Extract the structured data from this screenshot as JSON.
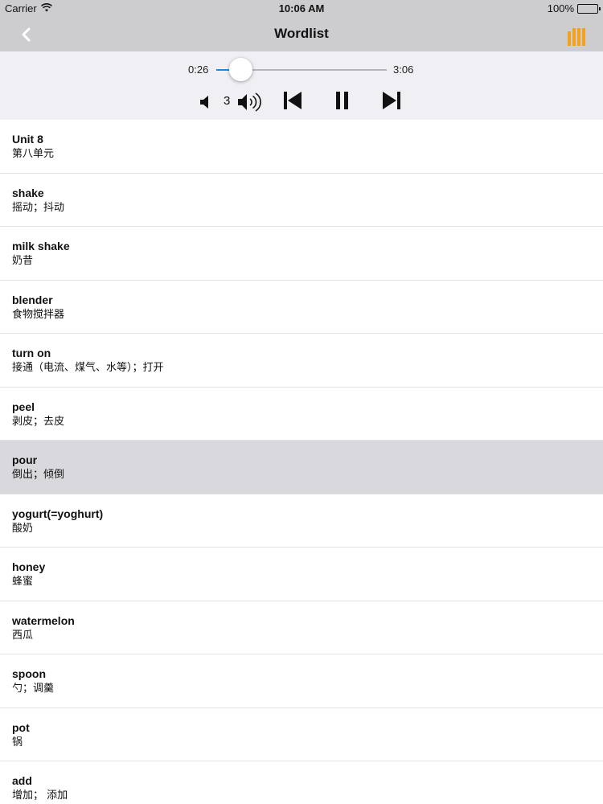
{
  "status_bar": {
    "carrier": "Carrier",
    "time": "10:06 AM",
    "battery": "100%",
    "wifi_icon": "wifi-icon",
    "battery_icon": "battery-icon"
  },
  "nav_bar": {
    "title": "Wordlist",
    "back_icon": "chevron-left-icon",
    "library_icon": "library-icon",
    "accent_color": "#f4a11c"
  },
  "player": {
    "elapsed": "0:26",
    "total": "3:06",
    "progress": 0.14,
    "volume_level": "3",
    "progress_color": "#1a8be0"
  },
  "words": [
    {
      "en": "Unit 8",
      "cn": "第八单元",
      "selected": false
    },
    {
      "en": "shake",
      "cn": "摇动；抖动",
      "selected": false
    },
    {
      "en": "milk shake",
      "cn": "奶昔",
      "selected": false
    },
    {
      "en": "blender",
      "cn": "食物搅拌器",
      "selected": false
    },
    {
      "en": "turn on",
      "cn": "接通（电流、煤气、水等）；打开",
      "selected": false
    },
    {
      "en": "peel",
      "cn": "剥皮；去皮",
      "selected": false
    },
    {
      "en": "pour",
      "cn": "倒出；倾倒",
      "selected": true
    },
    {
      "en": "yogurt(=yoghurt)",
      "cn": "酸奶",
      "selected": false
    },
    {
      "en": "honey",
      "cn": "蜂蜜",
      "selected": false
    },
    {
      "en": "watermelon",
      "cn": "西瓜",
      "selected": false
    },
    {
      "en": "spoon",
      "cn": "勺；调羹",
      "selected": false
    },
    {
      "en": "pot",
      "cn": "锅",
      "selected": false
    },
    {
      "en": "add",
      "cn": "增加； 添加",
      "selected": false
    }
  ]
}
